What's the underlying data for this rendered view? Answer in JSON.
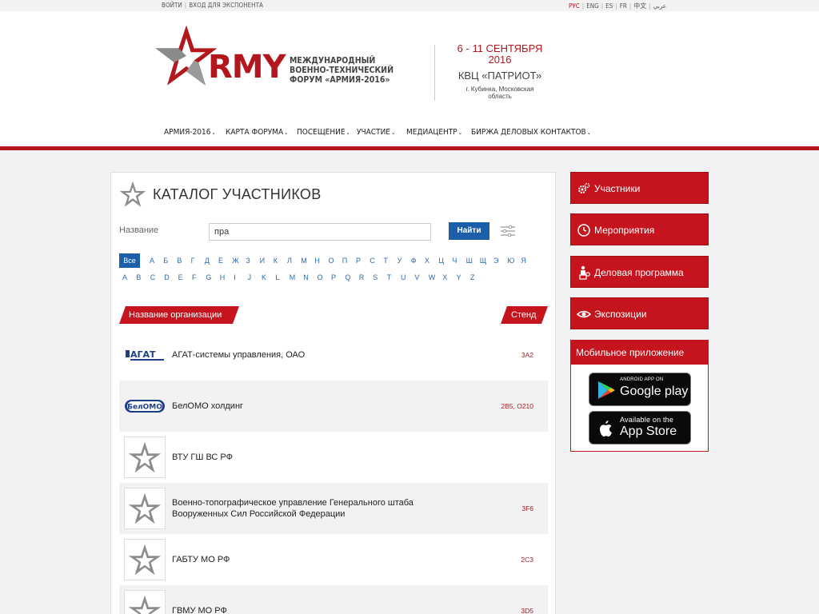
{
  "topbar": {
    "login": "Войти",
    "exhibitor_login": "Вход для экспонента",
    "languages": [
      "РУС",
      "ENG",
      "ES",
      "FR",
      "中文",
      "عربي"
    ]
  },
  "header": {
    "logo_text": "RMY",
    "forum_title": "Международный военно-технический форум «Армия-2016»",
    "dates": "6 - 11 СЕНТЯБРЯ 2016",
    "venue": "КВЦ «ПАТРИОТ»",
    "city": "г. Кубинка, Московская область"
  },
  "nav": {
    "items": [
      "Армия-2016",
      "Карта форума",
      "Посещение",
      "Участие",
      "Медиацентр",
      "Биржа деловых контактов"
    ]
  },
  "catalog": {
    "title": "КАТАЛОГ УЧАСТНИКОВ",
    "name_label": "Название",
    "search_value": "пра",
    "find_label": "Найти",
    "all_label": "Все",
    "cyrillic": [
      "А",
      "Б",
      "В",
      "Г",
      "Д",
      "Е",
      "Ж",
      "З",
      "И",
      "К",
      "Л",
      "М",
      "Н",
      "О",
      "П",
      "Р",
      "С",
      "Т",
      "У",
      "Ф",
      "Х",
      "Ц",
      "Ч",
      "Ш",
      "Щ",
      "Э",
      "Ю",
      "Я"
    ],
    "latin": [
      "A",
      "B",
      "C",
      "D",
      "E",
      "F",
      "G",
      "H",
      "I",
      "J",
      "K",
      "L",
      "M",
      "N",
      "O",
      "P",
      "Q",
      "R",
      "S",
      "T",
      "U",
      "V",
      "W",
      "X",
      "Y",
      "Z"
    ],
    "col_org": "Название организации",
    "col_stand": "Стенд",
    "rows": [
      {
        "org": "АГАТ-системы управления, ОАО",
        "stand": "3А2",
        "logo": "agat-logo",
        "logo_text": "АГАТ"
      },
      {
        "org": "БелОМО холдинг",
        "stand": "2B5, O210",
        "logo": "belomo-logo",
        "logo_text": "БелОМО"
      },
      {
        "org": "ВТУ ГШ ВС РФ",
        "stand": "",
        "logo": "army-star-logo",
        "logo_text": ""
      },
      {
        "org": "Военно-топографическое управление Генерального штаба Вооруженных Сил Российской Федерации",
        "stand": "3F6",
        "logo": "army-star-logo",
        "logo_text": ""
      },
      {
        "org": "ГАБТУ МО РФ",
        "stand": "2C3",
        "logo": "army-star-logo",
        "logo_text": ""
      },
      {
        "org": "ГВМУ МО РФ",
        "stand": "3D5",
        "logo": "army-star-logo",
        "logo_text": ""
      }
    ]
  },
  "sidebar": {
    "buttons": [
      {
        "label": "Участники",
        "icon": "gears-icon"
      },
      {
        "label": "Мероприятия",
        "icon": "clock-icon"
      },
      {
        "label": "Деловая программа",
        "icon": "speaker-icon"
      },
      {
        "label": "Экспозиции",
        "icon": "eye-icon"
      }
    ],
    "app_title": "Мобильное приложение",
    "google_small": "ANDROID APP ON",
    "google_big": "Google play",
    "apple_small": "Available on the",
    "apple_big": "App Store"
  },
  "colors": {
    "brand_red": "#c5141d",
    "link_blue": "#1d5ea8"
  }
}
